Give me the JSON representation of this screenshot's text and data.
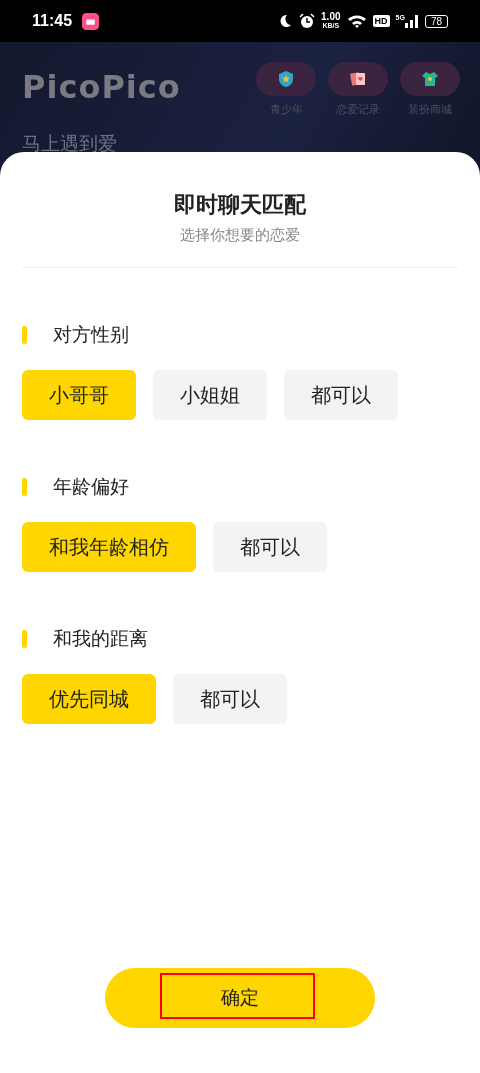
{
  "status_bar": {
    "time": "11:45",
    "net_speed": "1.00",
    "net_unit": "KB/S",
    "hd": "HD",
    "network": "5G",
    "battery": "78"
  },
  "header": {
    "logo": "PicoPico",
    "shortcuts": [
      {
        "label": "青少年",
        "kind": "shield"
      },
      {
        "label": "恋爱记录",
        "kind": "cards"
      },
      {
        "label": "装扮商城",
        "kind": "shirt"
      }
    ],
    "section_title": "马上遇到爱"
  },
  "sheet": {
    "title": "即时聊天匹配",
    "subtitle": "选择你想要的恋爱",
    "groups": [
      {
        "label": "对方性别",
        "options": [
          {
            "label": "小哥哥",
            "selected": true
          },
          {
            "label": "小姐姐",
            "selected": false
          },
          {
            "label": "都可以",
            "selected": false
          }
        ]
      },
      {
        "label": "年龄偏好",
        "options": [
          {
            "label": "和我年龄相仿",
            "selected": true
          },
          {
            "label": "都可以",
            "selected": false
          }
        ]
      },
      {
        "label": "和我的距离",
        "options": [
          {
            "label": "优先同城",
            "selected": true
          },
          {
            "label": "都可以",
            "selected": false
          }
        ]
      }
    ],
    "confirm": "确定"
  }
}
